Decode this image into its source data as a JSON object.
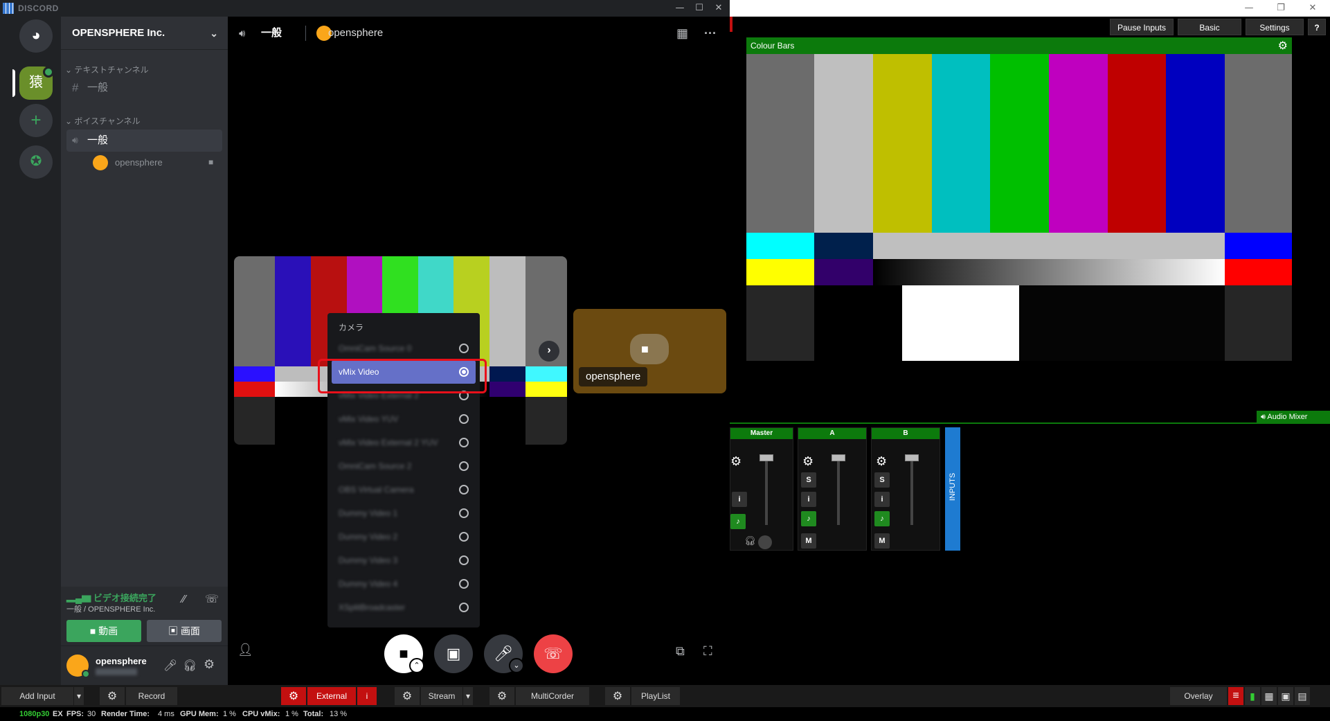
{
  "discord": {
    "brand": "DISCORD",
    "server_name": "OPENSPHERE Inc.",
    "text_category": "テキストチャンネル",
    "text_channel": "一般",
    "voice_category": "ボイスチャンネル",
    "voice_channel": "一般",
    "voice_user": "opensphere",
    "header_channel": "一般",
    "header_user": "opensphere",
    "voice_status": "ビデオ接続完了",
    "voice_location": "一般 / OPENSPHERE Inc.",
    "video_button": "動画",
    "screen_button": "画面",
    "username": "opensphere",
    "camera_menu_title": "カメラ",
    "camera_options": [
      {
        "label": "OmniCam Source 0",
        "selected": false
      },
      {
        "label": "vMix Video",
        "selected": true
      },
      {
        "label": "vMix Video External 2",
        "selected": false
      },
      {
        "label": "vMix Video YUV",
        "selected": false
      },
      {
        "label": "vMix Video External 2 YUV",
        "selected": false
      },
      {
        "label": "OmniCam Source 2",
        "selected": false
      },
      {
        "label": "OBS Virtual Camera",
        "selected": false
      },
      {
        "label": "Dummy Video 1",
        "selected": false
      },
      {
        "label": "Dummy Video 2",
        "selected": false
      },
      {
        "label": "Dummy Video 3",
        "selected": false
      },
      {
        "label": "Dummy Video 4",
        "selected": false
      },
      {
        "label": "XSplitBroadcaster",
        "selected": false
      }
    ],
    "tile_name": "opensphere"
  },
  "vmix": {
    "pause_inputs": "Pause Inputs",
    "basic": "Basic",
    "settings": "Settings",
    "help": "?",
    "preview_title": "Colour Bars",
    "audio_mixer": "Audio Mixer",
    "mixer_channels": [
      "Master",
      "A",
      "B"
    ],
    "inputs_label": "INPUTS",
    "solo": "S",
    "info": "i",
    "mute": "M",
    "bottom": {
      "add_input": "Add Input",
      "record": "Record",
      "external": "External",
      "external_info": "i",
      "stream": "Stream",
      "multicorder": "MultiCorder",
      "playlist": "PlayList",
      "overlay": "Overlay"
    },
    "status": {
      "format": "1080p30",
      "ex": "EX",
      "fps_label": "FPS:",
      "fps": "30",
      "render_label": "Render Time:",
      "render": "4 ms",
      "gpu_label": "GPU Mem:",
      "gpu": "1 %",
      "cpu_label": "CPU vMix:",
      "cpu": "1 %",
      "total_label": "Total:",
      "total": "13 %"
    }
  },
  "colors": {
    "discord_accent": "#5865f2",
    "discord_green": "#3ba55d",
    "discord_red": "#ed4245",
    "vmix_green": "#0c7a0c",
    "vmix_red": "#c31010"
  }
}
